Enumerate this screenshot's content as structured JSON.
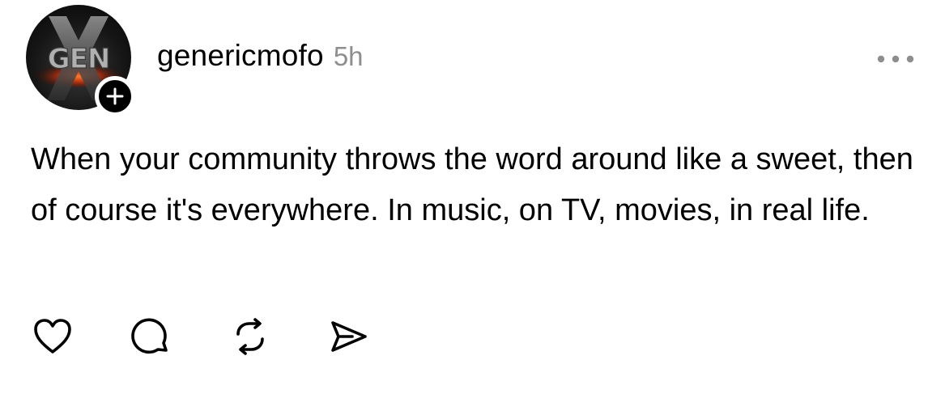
{
  "post": {
    "author": {
      "username": "genericmofo",
      "avatar_text": "GEN",
      "avatar_icon": "gen-x-logo-icon"
    },
    "timestamp": "5h",
    "follow_icon": "plus-icon",
    "more_icon": "ellipsis-icon",
    "body": "When your community throws the word around like a sweet, then of course it's everywhere. In music, on TV, movies, in real life.",
    "actions": [
      {
        "name": "like",
        "icon": "heart-icon"
      },
      {
        "name": "reply",
        "icon": "comment-icon"
      },
      {
        "name": "repost",
        "icon": "repost-icon"
      },
      {
        "name": "share",
        "icon": "send-icon"
      }
    ]
  },
  "colors": {
    "text": "#000000",
    "muted": "#8e8e8e",
    "background": "#ffffff",
    "avatar_accent": "#e8441a"
  }
}
